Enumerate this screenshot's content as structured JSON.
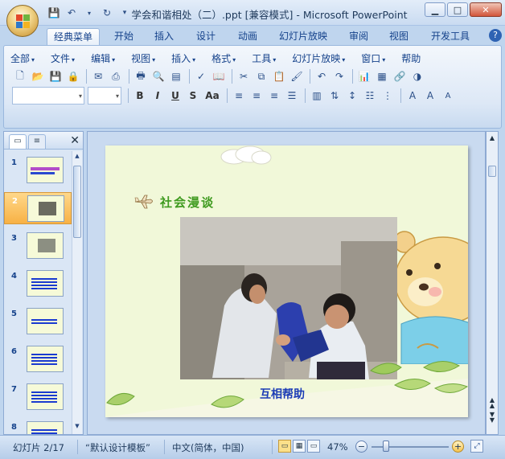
{
  "window": {
    "title": "学会和谐相处（二）.ppt [兼容模式] - Microsoft PowerPoint",
    "min": "▁",
    "max": "□",
    "close": "✕"
  },
  "ribbon_tabs": [
    {
      "label": "经典菜单",
      "active": true
    },
    {
      "label": "开始"
    },
    {
      "label": "插入"
    },
    {
      "label": "设计"
    },
    {
      "label": "动画"
    },
    {
      "label": "幻灯片放映"
    },
    {
      "label": "审阅"
    },
    {
      "label": "视图"
    },
    {
      "label": "开发工具"
    }
  ],
  "help": "?",
  "menu": [
    "全部",
    "文件",
    "编辑",
    "视图",
    "插入",
    "格式",
    "工具",
    "幻灯片放映",
    "窗口",
    "帮助"
  ],
  "format_buttons": [
    "B",
    "I",
    "U",
    "S",
    "Aa"
  ],
  "left_pane": {
    "tab_slides_icon": "▭",
    "tab_outline_icon": "≡",
    "close": "✕",
    "thumbnails": [
      "1",
      "2",
      "3",
      "4",
      "5",
      "6",
      "7",
      "8"
    ],
    "selected_index": 1
  },
  "slide": {
    "heading": "社会漫谈",
    "caption": "互相帮助"
  },
  "statusbar": {
    "slide_info": "幻灯片 2/17",
    "template": "“默认设计模板”",
    "language": "中文(简体，中国)",
    "zoom": "47%",
    "zoom_minus": "−",
    "zoom_plus": "+"
  },
  "colors": {
    "heading": "#3e9a1e",
    "caption": "#1b3bb6",
    "selected_thumb": "#f7b145"
  }
}
